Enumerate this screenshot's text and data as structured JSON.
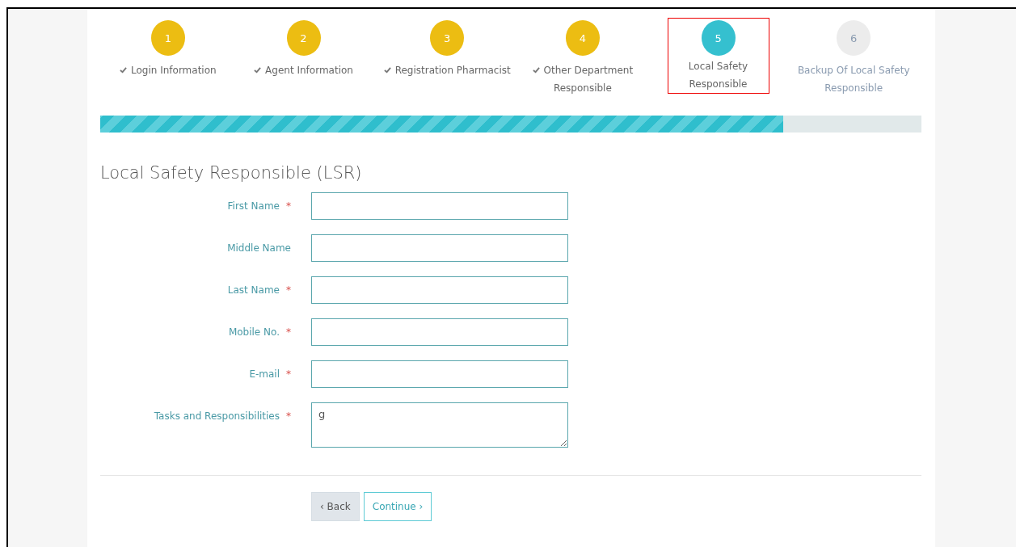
{
  "steps": [
    {
      "number": "1",
      "label": "Login Information",
      "completed": true,
      "selected": false,
      "highlighted": false
    },
    {
      "number": "2",
      "label": "Agent Information",
      "completed": true,
      "selected": false,
      "highlighted": false
    },
    {
      "number": "3",
      "label": "Registration Pharmacist",
      "completed": true,
      "selected": false,
      "highlighted": false
    },
    {
      "number": "4",
      "label": "Other Department Responsible",
      "completed": true,
      "selected": false,
      "highlighted": false
    },
    {
      "number": "5",
      "label": "Local Safety Responsible",
      "completed": false,
      "selected": true,
      "highlighted": true
    },
    {
      "number": "6",
      "label": "Backup Of Local Safety Responsible",
      "completed": false,
      "selected": false,
      "highlighted": false
    }
  ],
  "progress": {
    "level": 0.832
  },
  "form": {
    "title": "Local Safety Responsible (LSR)",
    "fields": [
      {
        "kind": "input",
        "label": "First Name",
        "required": true
      },
      {
        "kind": "input",
        "label": "Middle Name",
        "required": false
      },
      {
        "kind": "input",
        "label": "Last Name",
        "required": true
      },
      {
        "kind": "input",
        "label": "Mobile No.",
        "required": true
      },
      {
        "kind": "input",
        "label": "E-mail",
        "required": true
      },
      {
        "kind": "textarea",
        "label": "Tasks and Responsibilities",
        "required": true,
        "value": "g"
      }
    ],
    "required_mark": "*"
  },
  "buttons": [
    {
      "kind": "back",
      "label": "‹ Back"
    },
    {
      "kind": "continue",
      "label": "Continue ›"
    }
  ]
}
